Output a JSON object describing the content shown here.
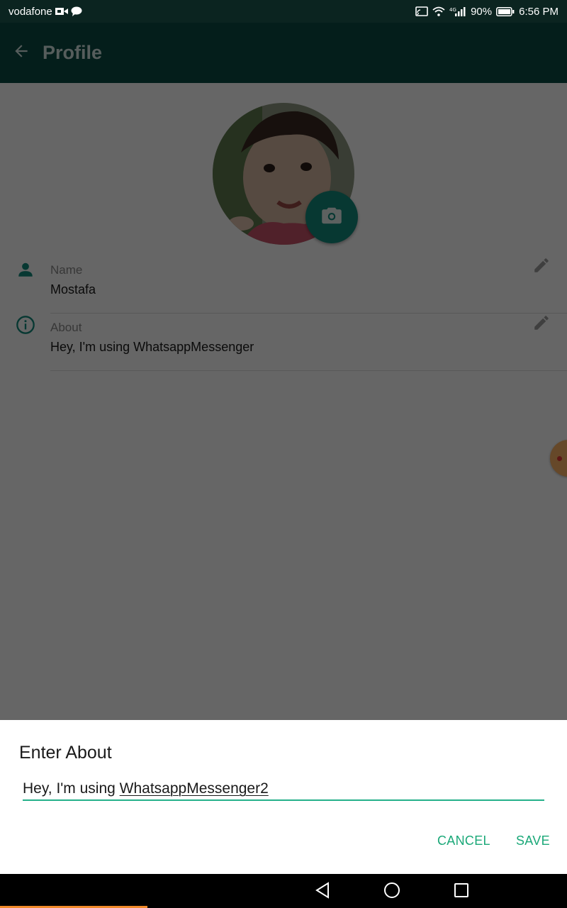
{
  "status_bar": {
    "carrier": "vodafone",
    "network_type": "4G",
    "battery": "90%",
    "time": "6:56 PM"
  },
  "app_bar": {
    "title": "Profile",
    "back_icon": "arrow-left-icon"
  },
  "profile": {
    "camera_icon": "camera-icon",
    "name_row": {
      "label": "Name",
      "value": "Mostafa",
      "icon": "person-icon",
      "edit_icon": "pencil-icon"
    },
    "about_row": {
      "label": "About",
      "value": "Hey, I'm using WhatsappMessenger",
      "icon": "info-icon",
      "edit_icon": "pencil-icon"
    }
  },
  "dialog": {
    "title": "Enter About",
    "input_prefix": "Hey, I'm using ",
    "input_typed": "WhatsappMessenger2",
    "cancel_label": "CANCEL",
    "save_label": "SAVE"
  },
  "nav_bar": {
    "back_icon": "triangle-back-icon",
    "home_icon": "circle-home-icon",
    "recent_icon": "square-recent-icon"
  },
  "colors": {
    "status_bar": "#0b2420",
    "app_bar": "#0b4d45",
    "accent_green": "#128c7e",
    "button_green": "#1aa878",
    "scrim": "rgba(0,0,0,0.6)"
  }
}
